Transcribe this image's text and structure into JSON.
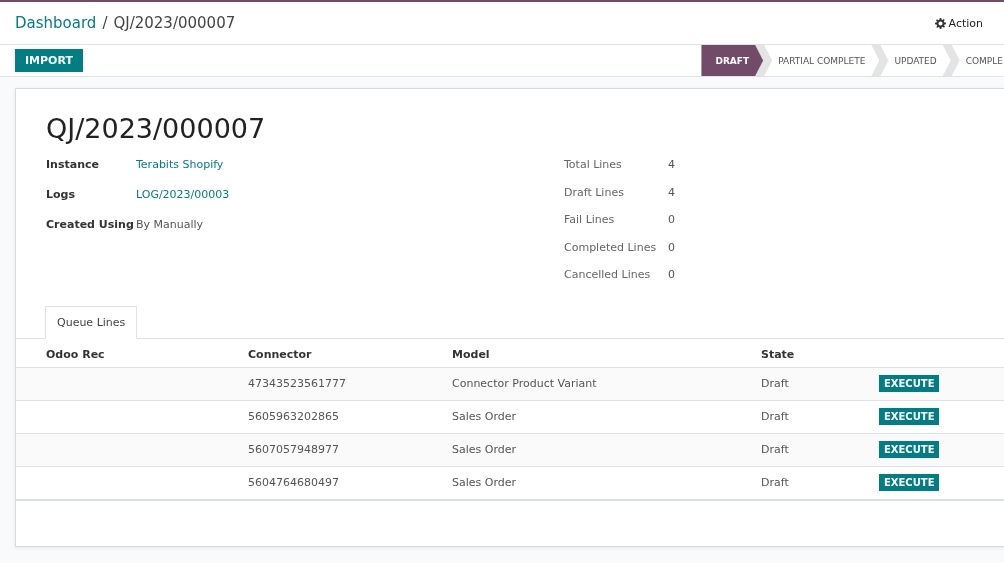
{
  "breadcrumb": {
    "parent": "Dashboard",
    "separator": "/",
    "current": "QJ/2023/000007"
  },
  "action": {
    "label": "Action"
  },
  "import_button": "IMPORT",
  "statuses": [
    {
      "label": "DRAFT",
      "selected": true
    },
    {
      "label": "PARTIAL COMPLETE",
      "selected": false
    },
    {
      "label": "UPDATED",
      "selected": false
    },
    {
      "label": "COMPLE",
      "selected": false
    }
  ],
  "title": "QJ/2023/000007",
  "fields": [
    {
      "label": "Instance",
      "value": "Terabits Shopify",
      "kind": "link"
    },
    {
      "label": "Logs",
      "value": "LOG/2023/00003",
      "kind": "link"
    },
    {
      "label": "Created Using",
      "value": "By Manually",
      "kind": "text"
    }
  ],
  "counts": [
    {
      "label": "Total Lines",
      "value": "4"
    },
    {
      "label": "Draft Lines",
      "value": "4"
    },
    {
      "label": "Fail Lines",
      "value": "0"
    },
    {
      "label": "Completed Lines",
      "value": "0"
    },
    {
      "label": "Cancelled Lines",
      "value": "0"
    }
  ],
  "tabs": [
    {
      "label": "Queue Lines",
      "selected": true
    }
  ],
  "table": {
    "columns": [
      "Odoo Rec",
      "Connector",
      "Model",
      "State"
    ],
    "rows": [
      {
        "connector": "47343523561777",
        "model": "Connector Product Variant",
        "state": "Draft",
        "button": "EXECUTE"
      },
      {
        "connector": "5605963202865",
        "model": "Sales Order",
        "state": "Draft",
        "button": "EXECUTE"
      },
      {
        "connector": "5607057948977",
        "model": "Sales Order",
        "state": "Draft",
        "button": "EXECUTE"
      },
      {
        "connector": "5604764680497",
        "model": "Sales Order",
        "state": "Draft",
        "button": "EXECUTE"
      }
    ]
  }
}
